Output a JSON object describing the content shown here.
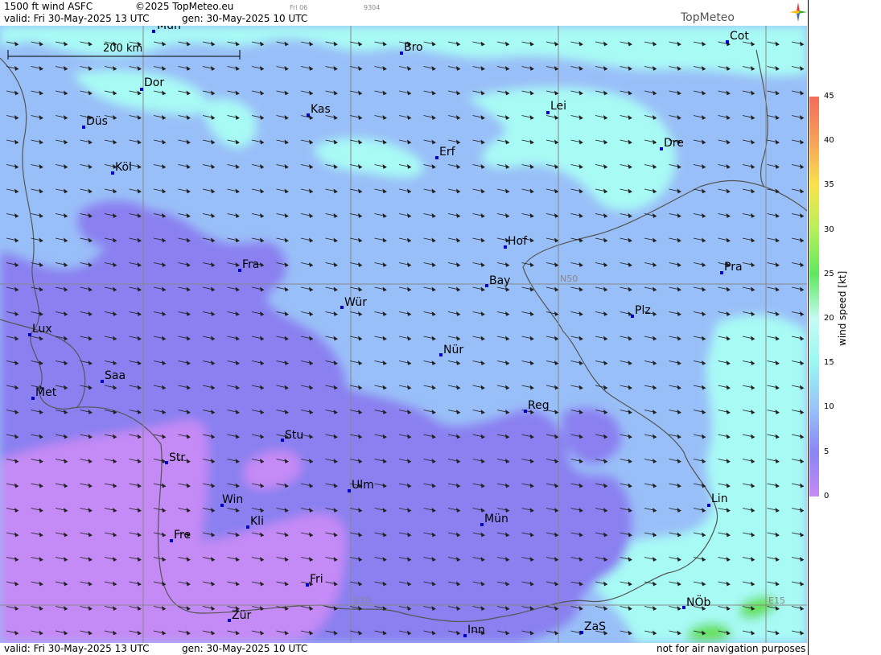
{
  "header": {
    "product": "1500 ft wind ASFC",
    "copyright": "©2025 TopMeteo.eu",
    "small1": "Fri 06",
    "small2": "9304",
    "valid": "valid:  Fri  30-May-2025  13 UTC",
    "gen": "gen: 30-May-2025 10 UTC",
    "logo": "TopMeteo"
  },
  "footer": {
    "valid": "valid:  Fri  30-May-2025  13 UTC",
    "gen": "gen: 30-May-2025 10 UTC",
    "disclaimer": "not for air navigation purposes"
  },
  "map": {
    "scale_label": "200 km",
    "grid_labels": [
      "N50",
      "E10",
      "E15"
    ],
    "cities": [
      "Mün",
      "Bro",
      "Cot",
      "Dor",
      "Kas",
      "Lei",
      "Düs",
      "Erf",
      "Dre",
      "Köl",
      "Hof",
      "Fra",
      "Pra",
      "Bay",
      "Wür",
      "Plz",
      "Lux",
      "Nür",
      "Saa",
      "Met",
      "Reg",
      "Stu",
      "Str",
      "Ulm",
      "Win",
      "Lin",
      "Kli",
      "Mün",
      "Fre",
      "Fri",
      "NÖb",
      "Zür",
      "ZaS",
      "Inn"
    ],
    "wind_direction": "west-northwest, arrows pointing east-southeast"
  },
  "colorbar": {
    "title": "wind speed [kt]",
    "ticks": [
      "45",
      "40",
      "35",
      "30",
      "25",
      "20",
      "15",
      "10",
      "5",
      "0"
    ],
    "colors": [
      "#f26b5a",
      "#f7a25a",
      "#f9e34b",
      "#b6f05a",
      "#5fe85f",
      "#c6fbf3",
      "#99f7f2",
      "#99c4f9",
      "#8a86f2",
      "#c68af6"
    ]
  },
  "colors": {
    "mauve": "#c48af5",
    "violet": "#8a80f0",
    "blue": "#99bff8",
    "cyan": "#a8faf5",
    "green": "#66e15a"
  }
}
